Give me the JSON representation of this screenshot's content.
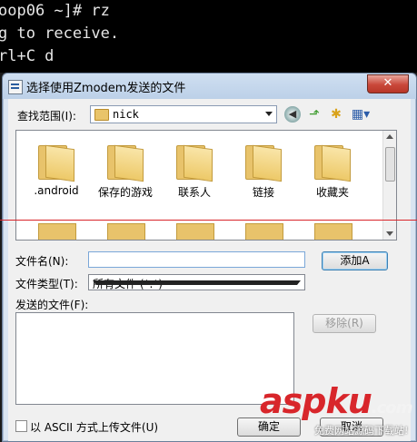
{
  "terminal": {
    "lines": [
      "oop06 ~]# rz",
      "g to receive.",
      "rl+C d"
    ]
  },
  "dialog": {
    "title": "选择使用Zmodem发送的文件",
    "close_symbol": "✕",
    "look_in_label": "查找范围(I):",
    "look_in_value": "nick",
    "files": [
      ".android",
      "保存的游戏",
      "联系人",
      "链接",
      "收藏夹"
    ],
    "filename_label": "文件名(N):",
    "filename_value": "",
    "add_button": "添加A",
    "filetype_label": "文件类型(T):",
    "filetype_value": "所有文件 (*.*)",
    "send_files_label": "发送的文件(F):",
    "remove_button": "移除(R)",
    "ascii_checkbox_label": "以 ASCII 方式上传文件(U)",
    "ok_button": "确定",
    "cancel_button": "取消"
  },
  "watermark": {
    "logo": "aspku",
    "logo_suffix": ".com",
    "subtitle": "免费网站源码下载站!"
  },
  "colors": {
    "close_red": "#c9483a",
    "watermark_red": "#d8262b",
    "guide_line_red": "#d9252a"
  }
}
